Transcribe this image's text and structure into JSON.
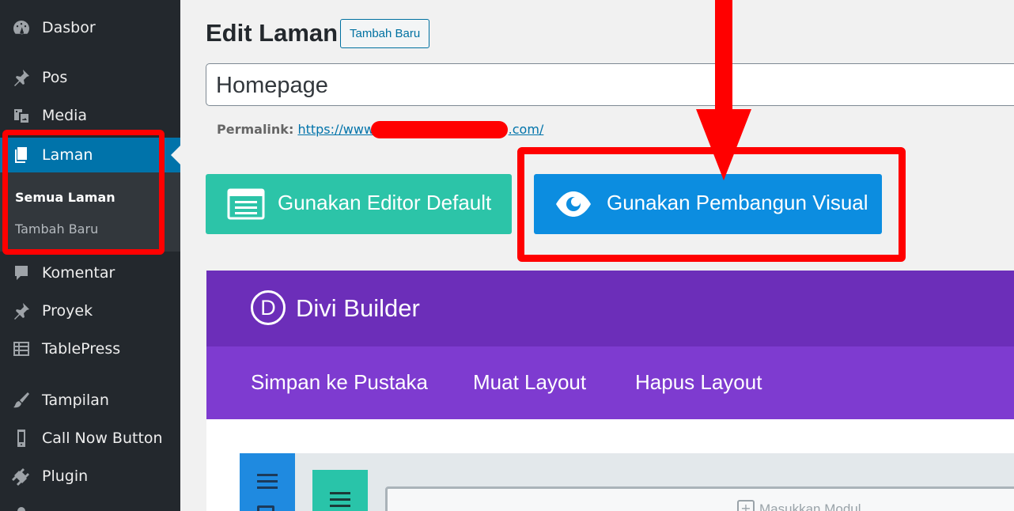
{
  "sidebar": {
    "items": [
      {
        "label": "Dasbor",
        "icon": "dashboard-icon"
      },
      {
        "label": "Pos",
        "icon": "pin-icon"
      },
      {
        "label": "Media",
        "icon": "media-icon"
      },
      {
        "label": "Laman",
        "icon": "pages-icon",
        "current": true
      },
      {
        "label": "Komentar",
        "icon": "comment-icon"
      },
      {
        "label": "Proyek",
        "icon": "pin-icon"
      },
      {
        "label": "TablePress",
        "icon": "table-icon"
      },
      {
        "label": "Tampilan",
        "icon": "brush-icon"
      },
      {
        "label": "Call Now Button",
        "icon": "phone-icon"
      },
      {
        "label": "Plugin",
        "icon": "plugin-icon"
      }
    ],
    "submenu": {
      "active": "Semua Laman",
      "other": "Tambah Baru"
    }
  },
  "header": {
    "title": "Edit Laman",
    "add_new": "Tambah Baru"
  },
  "post": {
    "title_value": "Homepage",
    "permalink_label": "Permalink:",
    "permalink_prefix": "https://www.",
    "permalink_suffix": ".com/"
  },
  "editor_buttons": {
    "default_label": "Gunakan Editor Default",
    "visual_label": "Gunakan Pembangun Visual"
  },
  "divi": {
    "title": "Divi Builder",
    "logo_letter": "D",
    "actions": [
      "Simpan ke Pustaka",
      "Muat Layout",
      "Hapus Layout"
    ],
    "insert_module": "Masukkan Modul"
  },
  "colors": {
    "sidebar_bg": "#23282d",
    "accent_blue": "#0073aa",
    "divi_purple": "#6c2eb9",
    "divi_bar_purple": "#7e3bd0",
    "default_btn": "#2cc4a8",
    "visual_btn": "#0c8de0",
    "annotation_red": "#ff0000"
  }
}
